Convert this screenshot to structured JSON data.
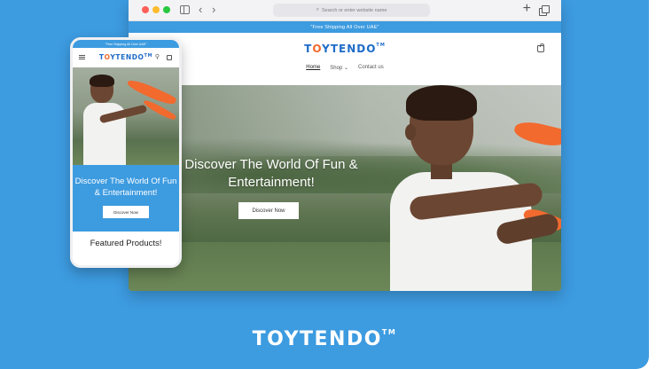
{
  "browser": {
    "address_bar_text": "Search or enter website name",
    "search_glyph": "⌕"
  },
  "store": {
    "announcement": "\"Free Shipping All Over UAE\"",
    "logo": {
      "part1": "T",
      "part2": "O",
      "part3": "YTENDO",
      "tm": "TM"
    },
    "nav": [
      "Home",
      "Shop ⌄",
      "Contact us"
    ],
    "hero": {
      "title": "Discover The World Of Fun & Entertainment!",
      "button": "Discover Now"
    }
  },
  "mobile": {
    "announcement": "\"Free Shipping All Over UAE\"",
    "hero_title": "Discover The World Of Fun & Entertainment!",
    "hero_button": "Discover Now",
    "section_title": "Featured Products!"
  },
  "footer_brand": {
    "part1": "T",
    "part2": "O",
    "part3": "YTENDO",
    "tm": "TM"
  },
  "colors": {
    "background": "#3d9be0",
    "brand_blue": "#1e6cc8",
    "brand_orange": "#f26a2e"
  },
  "icons": {
    "window_controls": [
      "close-dot",
      "minimize-dot",
      "zoom-dot"
    ],
    "toolbar": [
      "sidebar-icon",
      "back-arrow-icon",
      "forward-arrow-icon",
      "new-tab-plus-icon",
      "tabs-overview-icon"
    ],
    "site": [
      "cart-icon",
      "menu-icon",
      "search-icon"
    ]
  }
}
